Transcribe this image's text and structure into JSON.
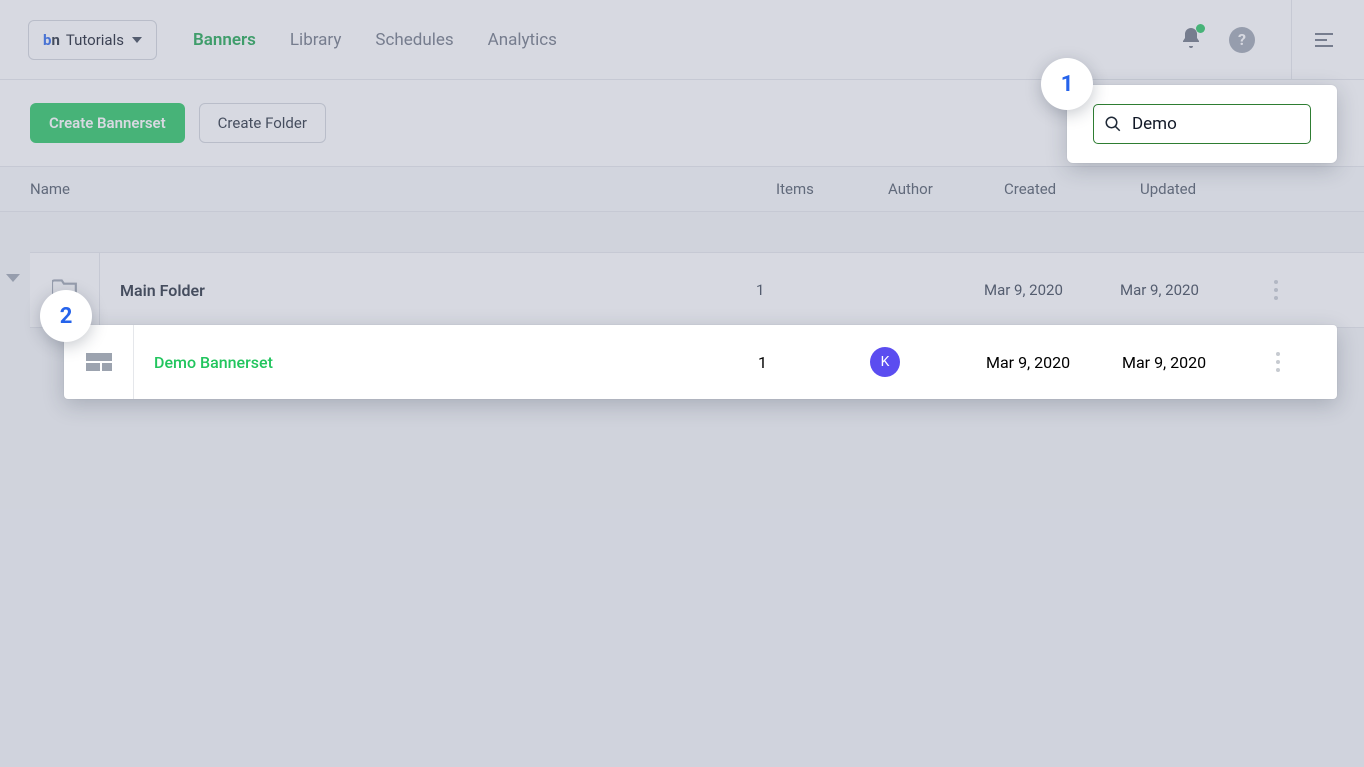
{
  "header": {
    "workspace_label": "Tutorials",
    "logo": {
      "b": "b",
      "n": "n"
    },
    "nav": {
      "banners": "Banners",
      "library": "Library",
      "schedules": "Schedules",
      "analytics": "Analytics"
    }
  },
  "toolbar": {
    "create_bannerset": "Create Bannerset",
    "create_folder": "Create Folder"
  },
  "columns": {
    "name": "Name",
    "items": "Items",
    "author": "Author",
    "created": "Created",
    "updated": "Updated"
  },
  "rows": {
    "folder": {
      "name": "Main Folder",
      "items": "1",
      "author": "",
      "created": "Mar 9, 2020",
      "updated": "Mar 9, 2020"
    },
    "result": {
      "name": "Demo Bannerset",
      "items": "1",
      "author_initial": "K",
      "created": "Mar 9, 2020",
      "updated": "Mar 9, 2020"
    }
  },
  "search": {
    "value": "Demo"
  },
  "markers": {
    "one": "1",
    "two": "2"
  },
  "help_glyph": "?"
}
